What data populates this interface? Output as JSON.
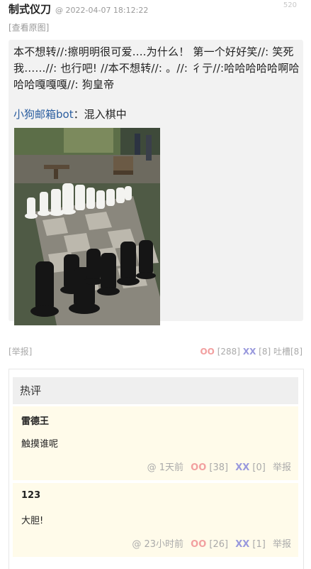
{
  "post": {
    "author": "制式仪刀",
    "meta": "@ 2022-04-07 18:12:22",
    "id_partial": "520",
    "view_original": "[查看原图]",
    "quote_text": "本不想转//:擦明明很可爱....为什么！ 第一个好好笑//: 笑死我……//: 也行吧! //本不想转//: 。//: 彳亍//:哈哈哈哈哈啊哈哈哈嘎嘎嘎//: 狗皇帝",
    "forward_bot": "小狗邮箱bot",
    "forward_sep": "：",
    "forward_text": "混入棋中",
    "image_alt": "giant chess pieces on a checkerboard in a park"
  },
  "actions": {
    "report": "[举报]",
    "oo_label": "OO",
    "oo_count": "[288]",
    "xx_label": "XX",
    "xx_count": "[8]",
    "tucao_label": "吐槽",
    "tucao_count": "[8]"
  },
  "hot": {
    "title": "热评",
    "comments": [
      {
        "user": "雷德王",
        "text": "触摸谁呢",
        "time": "@ 1天前",
        "oo_label": "OO",
        "oo_count": "[38]",
        "xx_label": "XX",
        "xx_count": "[0]",
        "report": "举报"
      },
      {
        "user": "123",
        "text": "大胆!",
        "time": "@ 23小时前",
        "oo_label": "OO",
        "oo_count": "[26]",
        "xx_label": "XX",
        "xx_count": "[1]",
        "report": "举报"
      }
    ]
  },
  "colors": {
    "oo": "#f2a0a0",
    "xx": "#9999dd",
    "bot": "#2a5d9f",
    "comment_bg": "#fffbea"
  }
}
